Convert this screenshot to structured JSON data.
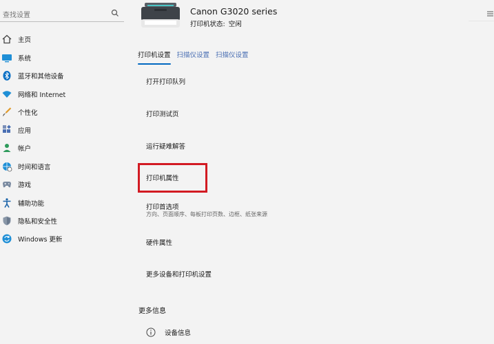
{
  "sidebar": {
    "search_placeholder": "查找设置",
    "items": [
      {
        "label": "主页",
        "icon": "home-icon"
      },
      {
        "label": "系统",
        "icon": "monitor-icon"
      },
      {
        "label": "蓝牙和其他设备",
        "icon": "bluetooth-icon"
      },
      {
        "label": "网络和 Internet",
        "icon": "wifi-icon"
      },
      {
        "label": "个性化",
        "icon": "brush-icon"
      },
      {
        "label": "应用",
        "icon": "apps-icon"
      },
      {
        "label": "帐户",
        "icon": "person-icon"
      },
      {
        "label": "时间和语言",
        "icon": "globe-clock-icon"
      },
      {
        "label": "游戏",
        "icon": "gamepad-icon"
      },
      {
        "label": "辅助功能",
        "icon": "accessibility-icon"
      },
      {
        "label": "隐私和安全性",
        "icon": "shield-icon"
      },
      {
        "label": "Windows 更新",
        "icon": "update-icon"
      }
    ]
  },
  "header": {
    "printer_name": "Canon G3020 series",
    "status_label": "打印机状态:",
    "status_value": "空闲"
  },
  "tabs": [
    {
      "label": "打印机设置",
      "active": true
    },
    {
      "label": "扫描仪设置",
      "active": false
    },
    {
      "label": "扫描仪设置",
      "active": false
    }
  ],
  "options": {
    "open_queue": "打开打印队列",
    "test_page": "打印测试页",
    "troubleshoot": "运行疑难解答",
    "printer_properties": "打印机属性",
    "preferences": "打印首选项",
    "preferences_desc": "方向、页面顺序、每板打印页数、边框、纸张来源",
    "hardware_properties": "硬件属性",
    "more_devices": "更多设备和打印机设置"
  },
  "more_info": {
    "heading": "更多信息",
    "device_info": "设备信息"
  },
  "colors": {
    "accent": "#0067c0",
    "highlight": "#d21a22",
    "background": "#f3f3f3"
  }
}
